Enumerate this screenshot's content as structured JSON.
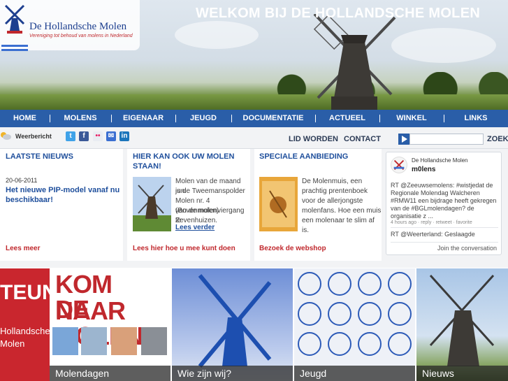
{
  "header": {
    "logo_title": "De Hollandsche Molen",
    "logo_subtitle": "Vereniging tot behoud van molens in Nederland",
    "welcome": "WELKOM BIJ DE HOLLANDSCHE MOLEN"
  },
  "nav": {
    "items": [
      {
        "label": "HOME"
      },
      {
        "label": "MOLENS"
      },
      {
        "label": "EIGENAAR"
      },
      {
        "label": "JEUGD"
      },
      {
        "label": "DOCUMENTATIE"
      },
      {
        "label": "ACTUEEL"
      },
      {
        "label": "WINKEL"
      },
      {
        "label": "LINKS"
      }
    ]
  },
  "util": {
    "weather_label": "Weerbericht",
    "social_icons": [
      "twitter-icon",
      "facebook-icon",
      "flickr-icon",
      "email-icon",
      "linkedin-icon"
    ],
    "lid_worden": "LID WORDEN",
    "contact": "CONTACT",
    "search_placeholder": "",
    "search_button": "ZOEK"
  },
  "news": {
    "title": "LAATSTE NIEUWS",
    "date": "20-06-2011",
    "headline_1": "Het nieuwe PIP-model vanaf nu",
    "headline_2": "beschikbaar!",
    "more": "Lees meer"
  },
  "molen": {
    "title_1": "HIER KAN OOK UW MOLEN",
    "title_2": "STAAN!",
    "lines": [
      "Molen van de maand juni",
      "is de Tweemanspolder",
      "Molen nr. 4 (Bovenmolen)",
      "van de molenviergang te",
      "Zevenhuizen."
    ],
    "read_more": "Lees verder",
    "link": "Lees hier hoe u mee kunt doen"
  },
  "offer": {
    "title": "SPECIALE AANBIEDING",
    "lines": [
      "De Molenmuis, een",
      "prachtig prentenboek",
      "voor de allerjongste",
      "molenfans. Hoe een muis",
      "een molenaar te slim af is."
    ],
    "link": "Bezoek de webshop"
  },
  "twitter": {
    "name": "De Hollandsche Molen",
    "handle": "m0lens",
    "tweet1_lines": [
      "RT @Zeeuwsemolens: #wistjedat de",
      "Regionale Molendag Walcheren",
      "#RMW11 een bijdrage heeft gekregen",
      "van de #BGLmolendagen? de",
      "organisatie z ..."
    ],
    "tweet1_meta": "4 hours ago · reply · retweet · favorite",
    "tweet2_lines": [
      "RT @Weerterland: Geslaagde"
    ],
    "join": "Join the conversation"
  },
  "tiles": {
    "t1_big": "TEUN",
    "t1_line1": "Hollandsche",
    "t1_line2": "Molen",
    "t2_line1": "KOM NAAR",
    "t2_line2": "DE MOLEN",
    "t2_caption": "Molendagen",
    "t3_caption": "Wie zijn wij?",
    "t4_caption": "Jeugd",
    "t5_caption": "Nieuws"
  },
  "colors": {
    "nav_blue": "#2a5ea8",
    "title_blue": "#1f4f9c",
    "link_red": "#c0282d"
  }
}
